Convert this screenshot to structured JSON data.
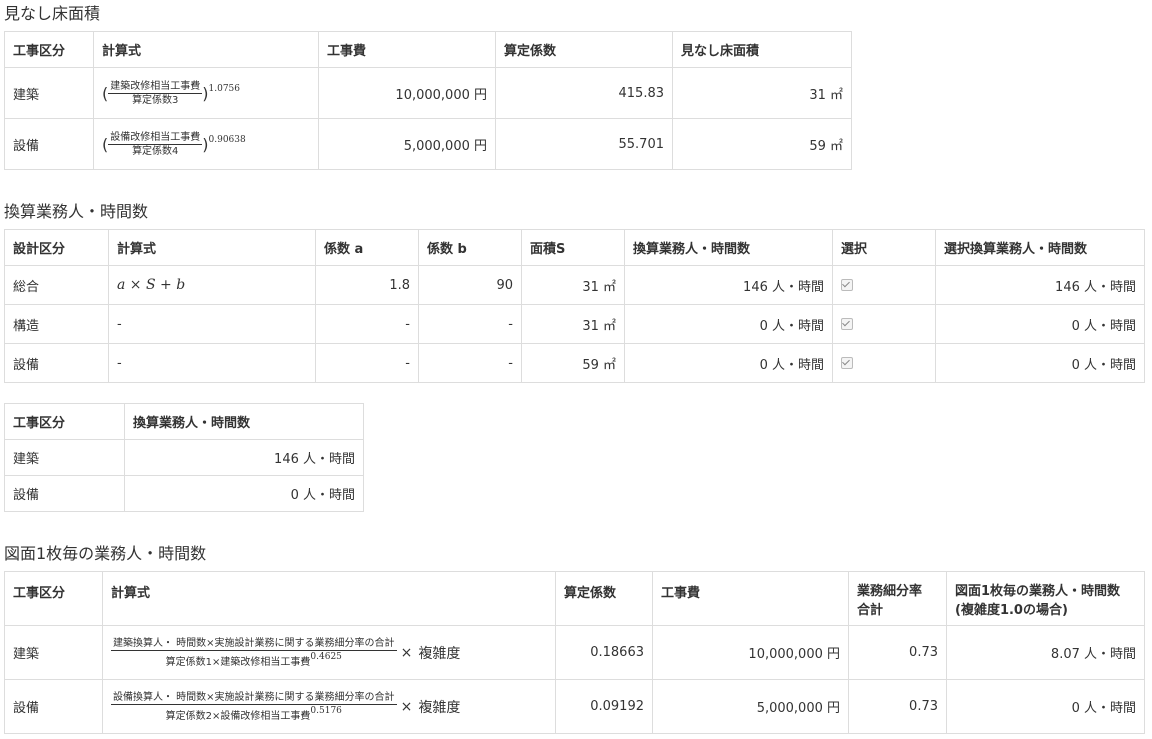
{
  "sec1": {
    "title": "見なし床面積",
    "headers": [
      "工事区分",
      "計算式",
      "工事費",
      "算定係数",
      "見なし床面積"
    ],
    "rows": [
      {
        "kubun": "建築",
        "num": "建築改修相当工事費",
        "den": "算定係数3",
        "exp": "1.0756",
        "cost": "10,000,000 円",
        "coef": "415.83",
        "area": "31 ㎡"
      },
      {
        "kubun": "設備",
        "num": "設備改修相当工事費",
        "den": "算定係数4",
        "exp": "0.90638",
        "cost": "5,000,000 円",
        "coef": "55.701",
        "area": "59 ㎡"
      }
    ]
  },
  "sec2": {
    "title": "換算業務人・時間数",
    "headers": [
      "設計区分",
      "計算式",
      "係数 a",
      "係数 b",
      "面積S",
      "換算業務人・時間数",
      "選択",
      "選択換算業務人・時間数"
    ],
    "formula": "a × S + b",
    "rows": [
      {
        "kubun": "総合",
        "formula": "a × S + b",
        "a": "1.8",
        "b": "90",
        "s": "31 ㎡",
        "hours": "146 人・時間",
        "sel": "146 人・時間"
      },
      {
        "kubun": "構造",
        "formula": "-",
        "a": "-",
        "b": "-",
        "s": "31 ㎡",
        "hours": "0 人・時間",
        "sel": "0 人・時間"
      },
      {
        "kubun": "設備",
        "formula": "-",
        "a": "-",
        "b": "-",
        "s": "59 ㎡",
        "hours": "0 人・時間",
        "sel": "0 人・時間"
      }
    ]
  },
  "sec3": {
    "headers": [
      "工事区分",
      "換算業務人・時間数"
    ],
    "rows": [
      {
        "kubun": "建築",
        "hours": "146 人・時間"
      },
      {
        "kubun": "設備",
        "hours": "0 人・時間"
      }
    ]
  },
  "sec4": {
    "title": "図面1枚毎の業務人・時間数",
    "headers": [
      "工事区分",
      "計算式",
      "算定係数",
      "工事費",
      "業務細分率\n合計",
      "図面1枚毎の業務人・時間数\n(複雑度1.0の場合)"
    ],
    "h5a": "業務細分率",
    "h5b": "合計",
    "h6a": "図面1枚毎の業務人・時間数",
    "h6b": "(複雑度1.0の場合)",
    "complexity": "複雑度",
    "rows": [
      {
        "kubun": "建築",
        "num": "建築換算人・ 時間数×実施設計業務に関する業務細分率の合計",
        "den": "算定係数1×建築改修相当工事費",
        "exp": "0.4625",
        "coef": "0.18663",
        "cost": "10,000,000 円",
        "rate": "0.73",
        "hours": "8.07 人・時間"
      },
      {
        "kubun": "設備",
        "num": "設備換算人・ 時間数×実施設計業務に関する業務細分率の合計",
        "den": "算定係数2×設備改修相当工事費",
        "exp": "0.5176",
        "coef": "0.09192",
        "cost": "5,000,000 円",
        "rate": "0.73",
        "hours": "0 人・時間"
      }
    ]
  }
}
